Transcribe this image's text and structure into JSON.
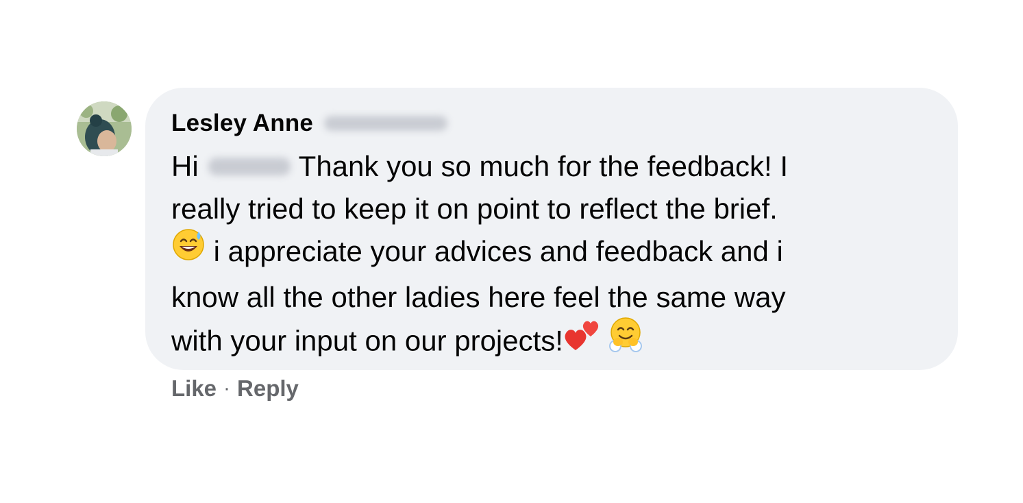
{
  "comment": {
    "author_name": "Lesley Anne",
    "author_surname_redacted": "Padilla",
    "greeting": "Hi",
    "recipient_redacted": "Kelli",
    "lines": [
      "Thank you so much for the feedback! I",
      "really tried to keep it on point to reflect the brief.",
      "i appreciate your advices and feedback and i",
      "know all the other ladies here feel the same way",
      "with your input on our projects!"
    ],
    "emoji": {
      "sweat_smile": "grinning-face-with-sweat-icon",
      "hearts": "two-hearts-icon",
      "hug": "hugging-face-icon"
    }
  },
  "actions": {
    "like_label": "Like",
    "separator": "·",
    "reply_label": "Reply"
  },
  "colors": {
    "bubble_bg": "#f0f2f5",
    "text": "#050505",
    "secondary_text": "#65676b"
  }
}
